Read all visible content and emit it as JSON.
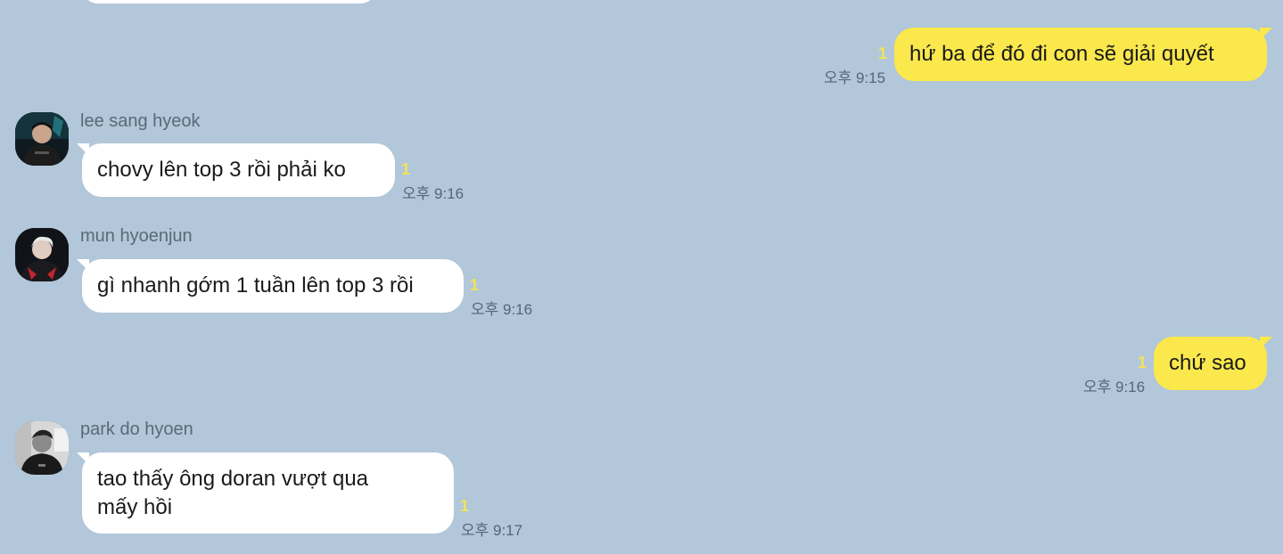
{
  "colors": {
    "background": "#b2c7d9",
    "incoming_bubble": "#ffffff",
    "outgoing_bubble": "#fae84c",
    "unread_count": "#f2e35a",
    "meta_text": "#556677"
  },
  "messages": [
    {
      "direction": "outgoing",
      "text": "hứ ba để đó đi con sẽ giải quyết",
      "unread": "1",
      "time": "오후 9:15"
    },
    {
      "direction": "incoming",
      "sender": "lee sang hyeok",
      "avatar_icon": "profile-photo-icon",
      "text": "chovy lên top 3 rồi phải ko",
      "unread": "1",
      "time": "오후 9:16"
    },
    {
      "direction": "incoming",
      "sender": "mun hyoenjun",
      "avatar_icon": "profile-photo-icon",
      "text": "gì nhanh gớm 1 tuần lên top 3 rồi",
      "unread": "1",
      "time": "오후 9:16"
    },
    {
      "direction": "outgoing",
      "text": "chứ sao",
      "unread": "1",
      "time": "오후 9:16"
    },
    {
      "direction": "incoming",
      "sender": "park do hyoen",
      "avatar_icon": "profile-photo-icon",
      "text_line1": "tao thấy ông doran vượt qua",
      "text_line2": "mấy hồi",
      "unread": "1",
      "time": "오후 9:17"
    }
  ]
}
